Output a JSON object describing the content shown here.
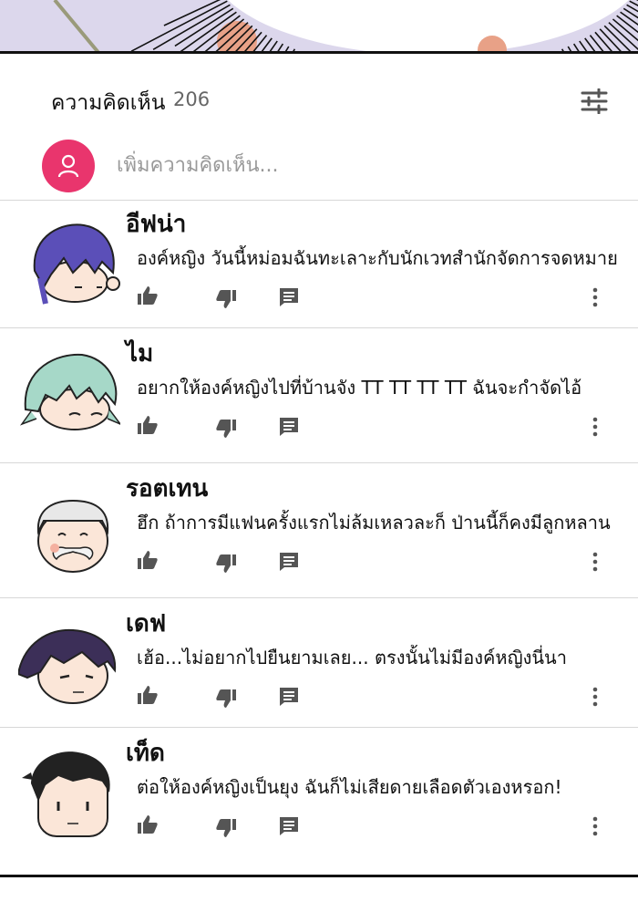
{
  "header": {
    "title": "ความคิดเห็น",
    "count": "206",
    "filter_icon": "sliders-icon"
  },
  "add_comment": {
    "placeholder": "เพิ่มความคิดเห็น...",
    "avatar_icon": "user-icon",
    "avatar_color": "#e9356d"
  },
  "comments": [
    {
      "name": "อีฟน่า",
      "text": "องค์หญิง วันนี้หม่อมฉันทะเลาะกับนักเวทสำนักจัดการจดหมาย"
    },
    {
      "name": "ไม",
      "text": "อยากให้องค์หญิงไปที่บ้านจัง TT TT TT TT ฉันจะกำจัดไอ้"
    },
    {
      "name": "รอตเทน",
      "text": "ฮึก ถ้าการมีแฟนครั้งแรกไม่ล้มเหลวละก็ ป่านนี้ก็คงมีลูกหลาน"
    },
    {
      "name": "เดฟ",
      "text": "เฮ้อ...ไม่อยากไปยืนยามเลย... ตรงนั้นไม่มีองค์หญิงนี่นา"
    },
    {
      "name": "เท็ด",
      "text": "ต่อให้องค์หญิงเป็นยุง ฉันก็ไม่เสียดายเลือดตัวเองหรอก!"
    }
  ]
}
